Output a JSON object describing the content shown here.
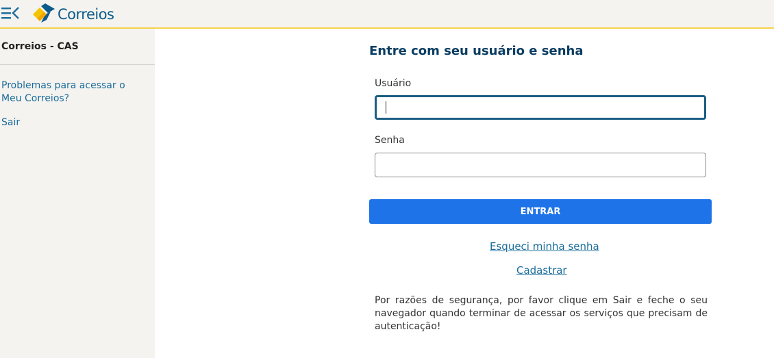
{
  "header": {
    "menu_icon": "menu-collapse-icon",
    "logo_icon": "correios-diamond-logo",
    "brand": "Correios",
    "colors": {
      "brand_blue": "#0a5a8c",
      "brand_yellow": "#f5c400",
      "accent_line": "#f5d24a"
    }
  },
  "sidebar": {
    "title": "Correios - CAS",
    "links": [
      {
        "label": "Problemas para acessar o Meu Correios?"
      },
      {
        "label": "Sair"
      }
    ]
  },
  "login": {
    "heading": "Entre com seu usuário e senha",
    "username_label": "Usuário",
    "username_value": "",
    "password_label": "Senha",
    "password_value": "",
    "submit_label": "ENTRAR",
    "forgot_link": "Esqueci minha senha",
    "register_link": "Cadastrar",
    "security_note": "Por razões de segurança, por favor clique em Sair e feche o seu navegador quando terminar de acessar os serviços que precisam de autenticação!",
    "colors": {
      "button": "#1e73e8",
      "link": "#1a6c9c",
      "heading": "#0a3d62"
    }
  }
}
